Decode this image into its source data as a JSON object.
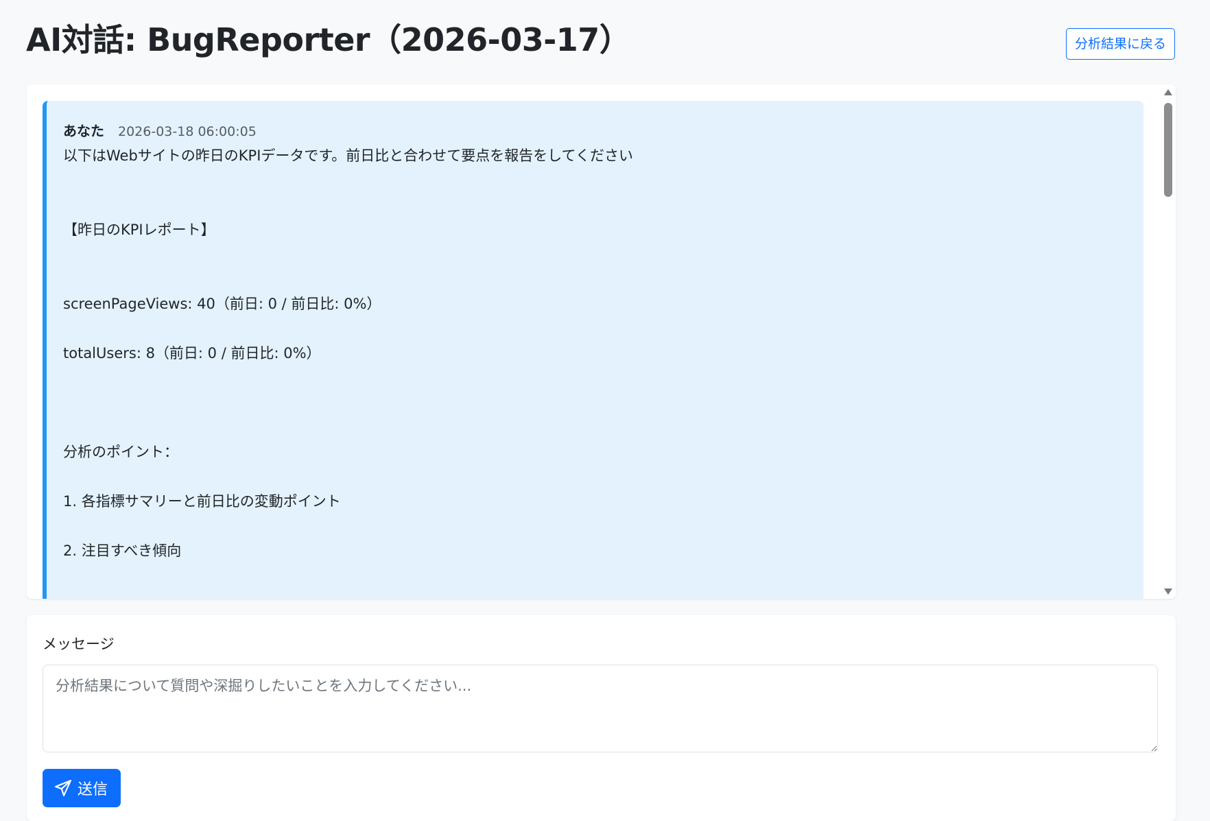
{
  "header": {
    "title": "AI対話: BugReporter（2026-03-17）",
    "back_label": "分析結果に戻る"
  },
  "chat": {
    "messages": [
      {
        "author": "あなた",
        "timestamp": "2026-03-18 06:00:05",
        "lines": [
          "以下はWebサイトの昨日のKPIデータです。前日比と合わせて要点を報告をしてください",
          "",
          "",
          "【昨日のKPIレポート】",
          "",
          "",
          "screenPageViews: 40（前日: 0 / 前日比: 0%）",
          "",
          "totalUsers: 8（前日: 0 / 前日比: 0%）",
          "",
          "",
          "",
          "分析のポイント：",
          "",
          "1. 各指標サマリーと前日比の変動ポイント",
          "",
          "2. 注目すべき傾向"
        ]
      }
    ]
  },
  "form": {
    "label": "メッセージ",
    "placeholder": "分析結果について質問や深掘りしたいことを入力してください...",
    "value": "",
    "send_label": "送信",
    "send_icon": "send-icon"
  },
  "colors": {
    "primary": "#0d6efd",
    "bubble_bg": "#e3f2fd",
    "bubble_border": "#2196f3",
    "page_bg": "#f8f9fa"
  }
}
